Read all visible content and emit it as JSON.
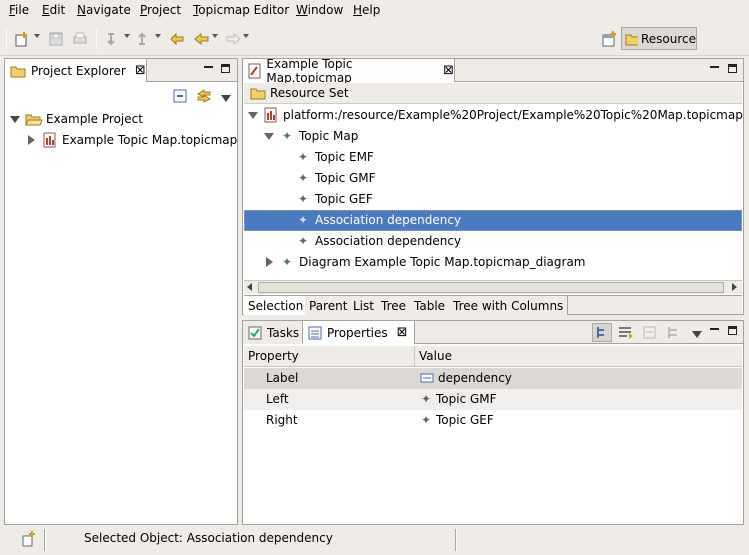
{
  "menu": [
    {
      "mn": "F",
      "rest": "ile"
    },
    {
      "mn": "E",
      "rest": "dit"
    },
    {
      "mn": "N",
      "rest": "avigate"
    },
    {
      "mn": "P",
      "rest": "roject"
    },
    {
      "mn": "T",
      "rest": "opicmap Editor"
    },
    {
      "mn": "W",
      "rest": "indow"
    },
    {
      "mn": "H",
      "rest": "elp"
    }
  ],
  "perspective": {
    "label": "Resource"
  },
  "project_explorer": {
    "title": "Project Explorer",
    "items": [
      {
        "label": "Example Project"
      },
      {
        "label": "Example Topic Map.topicmap"
      }
    ]
  },
  "editor": {
    "title": "Example Topic Map.topicmap",
    "resource_set": "Resource Set",
    "root": "platform:/resource/Example%20Project/Example%20Topic%20Map.topicmap",
    "topic_map": "Topic Map",
    "children": [
      {
        "label": "Topic EMF"
      },
      {
        "label": "Topic GMF"
      },
      {
        "label": "Topic GEF"
      },
      {
        "label": "Association dependency"
      },
      {
        "label": "Association dependency"
      }
    ],
    "diagram": "Diagram Example Topic Map.topicmap_diagram",
    "bottom_tabs": [
      "Selection",
      "Parent",
      "List",
      "Tree",
      "Table",
      "Tree with Columns"
    ]
  },
  "properties_view": {
    "tabs": [
      "Tasks",
      "Properties"
    ],
    "columns": [
      "Property",
      "Value"
    ],
    "rows": [
      {
        "property": "Label",
        "value": "dependency"
      },
      {
        "property": "Left",
        "value": "Topic GMF"
      },
      {
        "property": "Right",
        "value": "Topic GEF"
      }
    ]
  },
  "status": {
    "text": "Selected Object: Association dependency"
  },
  "colors": {
    "selection": "#4a7bc0",
    "background": "#efebe7"
  }
}
